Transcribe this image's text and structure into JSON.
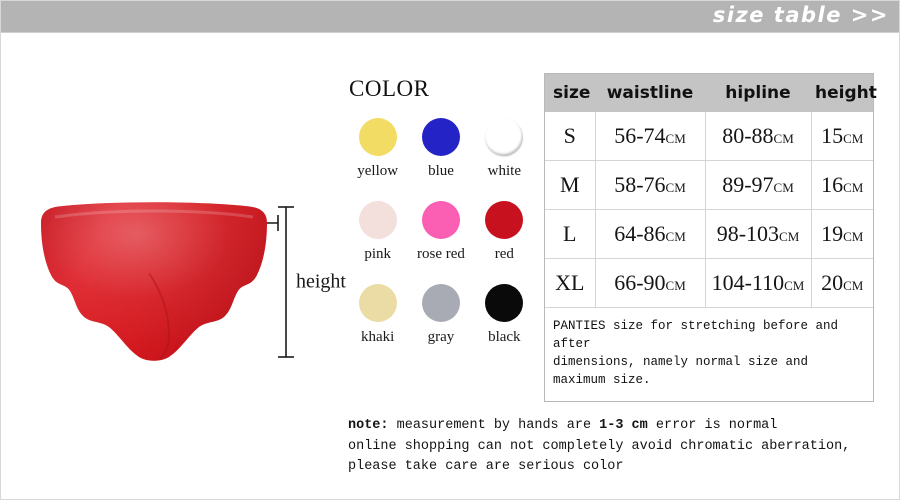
{
  "header": {
    "title": "size table >>",
    "background_color": "#b4b4b4",
    "text_color": "#ffffff"
  },
  "product": {
    "waistline_label": "waistline",
    "height_label": "height",
    "garment_color": "#cf1a22",
    "garment_name": "red-panties-photo"
  },
  "color_section": {
    "title": "COLOR",
    "swatches": [
      {
        "name": "yellow",
        "hex": "#f3dc64",
        "outlined": false
      },
      {
        "name": "blue",
        "hex": "#2424c6",
        "outlined": false
      },
      {
        "name": "white",
        "hex": "#ffffff",
        "outlined": true
      },
      {
        "name": "pink",
        "hex": "#f3e0dc",
        "outlined": false
      },
      {
        "name": "rose red",
        "hex": "#fa5fb4",
        "outlined": false
      },
      {
        "name": "red",
        "hex": "#c8111e",
        "outlined": false
      },
      {
        "name": "khaki",
        "hex": "#ebdca5",
        "outlined": false
      },
      {
        "name": "gray",
        "hex": "#a8abb4",
        "outlined": false
      },
      {
        "name": "black",
        "hex": "#0a0a0a",
        "outlined": false
      }
    ]
  },
  "size_table": {
    "headers": [
      "size",
      "waistline",
      "hipline",
      "height"
    ],
    "header_background": "#c4c4c4",
    "unit": "CM",
    "rows": [
      {
        "size": "S",
        "waistline": "56-74",
        "hipline": "80-88",
        "height": "15"
      },
      {
        "size": "M",
        "waistline": "58-76",
        "hipline": "89-97",
        "height": "16"
      },
      {
        "size": "L",
        "waistline": "64-86",
        "hipline": "98-103",
        "height": "19"
      },
      {
        "size": "XL",
        "waistline": "66-90",
        "hipline": "104-110",
        "height": "20"
      }
    ],
    "note": "PANTIES size for stretching before and after\ndimensions, namely normal size and maximum size."
  },
  "bottom_note": {
    "lead": "note:",
    "part1": " measurement by hands are ",
    "strong": "1-3 cm",
    "part2": " error is normal",
    "line2": "online shopping can not completely avoid chromatic aberration,",
    "line3": "please take care are serious color"
  }
}
